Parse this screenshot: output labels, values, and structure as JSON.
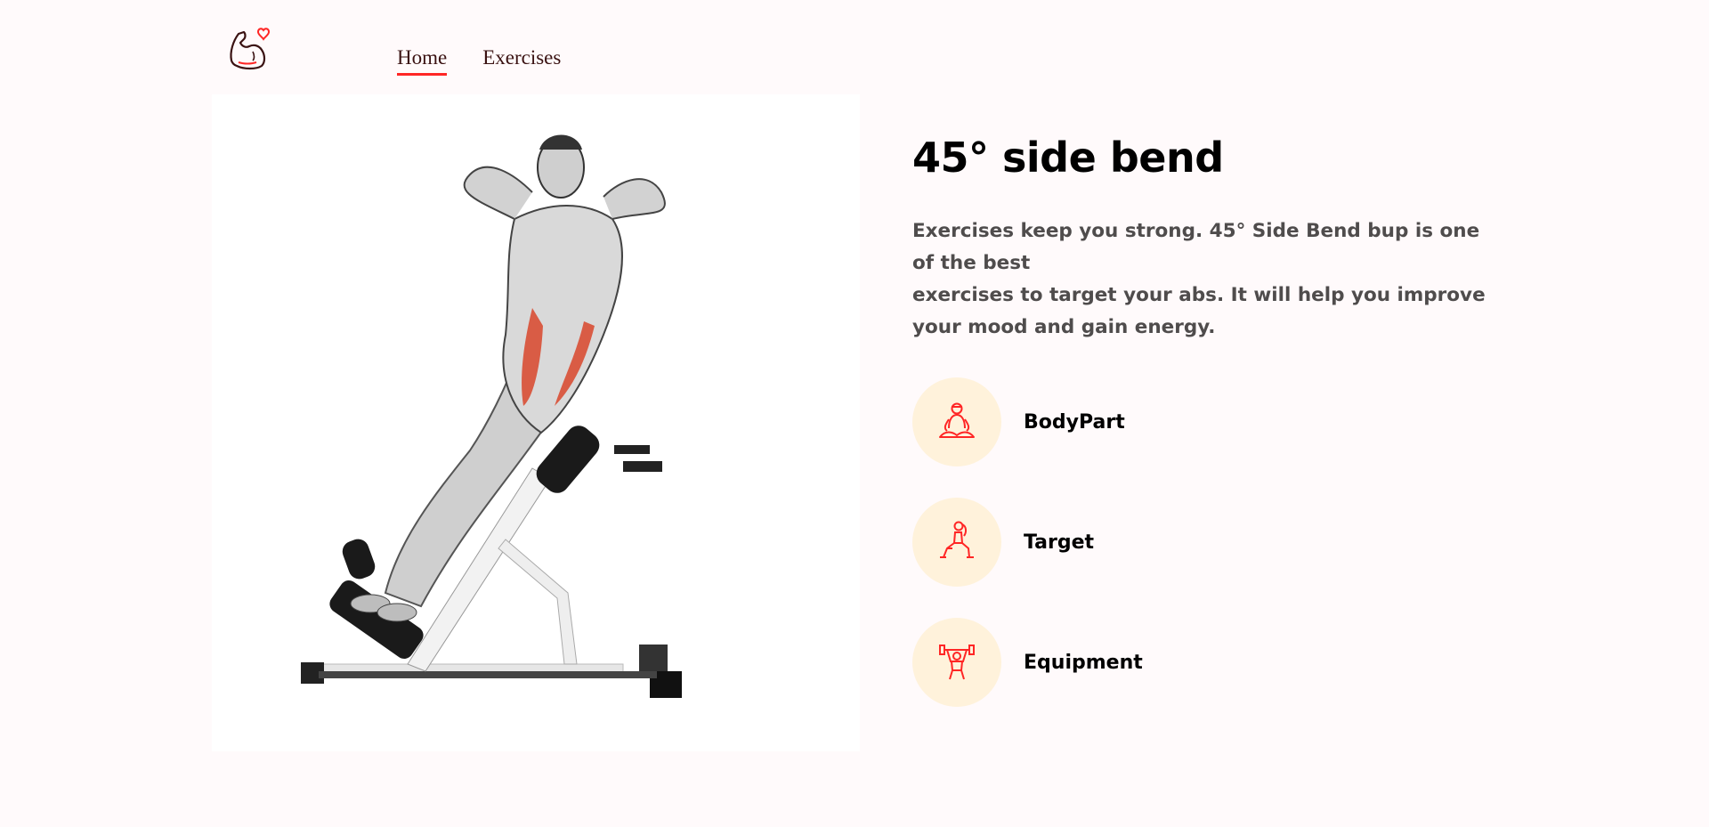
{
  "header": {
    "logo_icon": "flexed-arm-heart-icon",
    "nav": [
      {
        "label": "Home",
        "active": true
      },
      {
        "label": "Exercises",
        "active": false
      }
    ]
  },
  "exercise": {
    "image_alt": "45° side bend illustration",
    "name": "45° side bend",
    "description_line1": "Exercises keep you strong. 45° Side Bend bup is one of the best",
    "description_line2": "exercises to target your abs. It will help you improve your mood and gain energy.",
    "details": [
      {
        "icon": "meditation-body-icon",
        "label": "BodyPart"
      },
      {
        "icon": "lunge-target-icon",
        "label": "Target"
      },
      {
        "icon": "dumbbell-lift-icon",
        "label": "Equipment"
      }
    ]
  },
  "colors": {
    "accent": "#ff2625",
    "background": "#fffafb",
    "icon_circle": "#fff2db",
    "text_dark": "#000000",
    "text_muted": "#4f4c4c"
  }
}
